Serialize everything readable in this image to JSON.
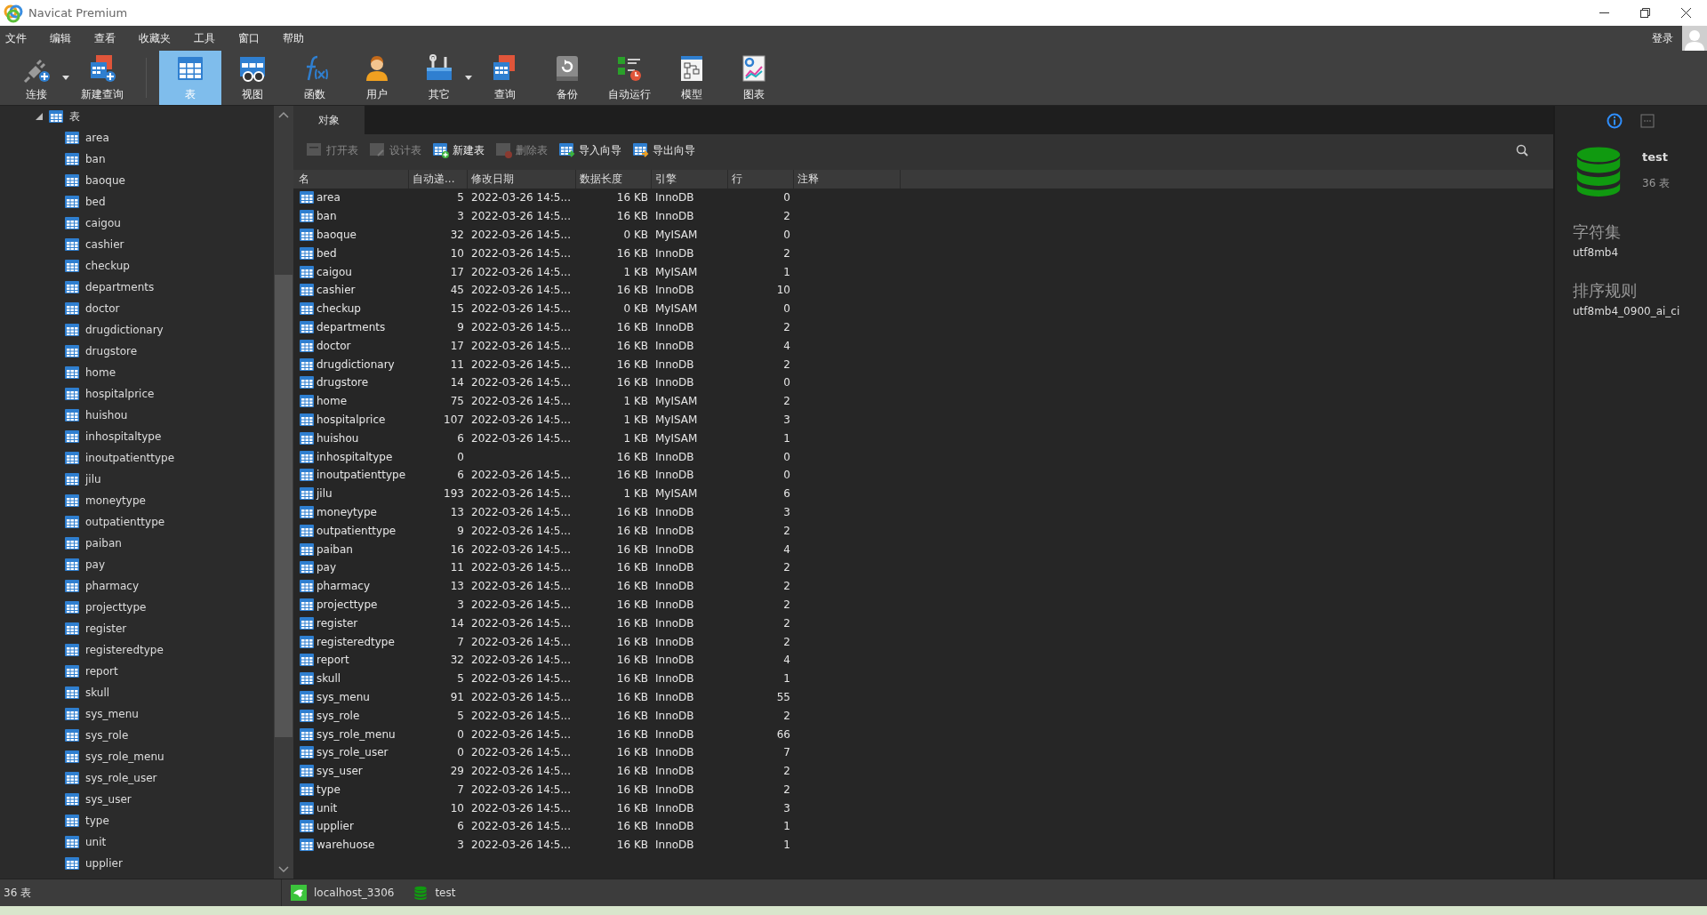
{
  "window": {
    "title": "Navicat Premium"
  },
  "menu": [
    "文件",
    "编辑",
    "查看",
    "收藏夹",
    "工具",
    "窗口",
    "帮助"
  ],
  "account": {
    "label": "登录"
  },
  "toolbar": [
    {
      "label": "连接",
      "selected": false,
      "dropdown": true
    },
    {
      "label": "新建查询",
      "selected": false,
      "dropdown": false
    },
    {
      "label": "表",
      "selected": true,
      "dropdown": false
    },
    {
      "label": "视图",
      "selected": false,
      "dropdown": false
    },
    {
      "label": "函数",
      "selected": false,
      "dropdown": false
    },
    {
      "label": "用户",
      "selected": false,
      "dropdown": false
    },
    {
      "label": "其它",
      "selected": false,
      "dropdown": true
    },
    {
      "label": "查询",
      "selected": false,
      "dropdown": false
    },
    {
      "label": "备份",
      "selected": false,
      "dropdown": false
    },
    {
      "label": "自动运行",
      "selected": false,
      "dropdown": false
    },
    {
      "label": "模型",
      "selected": false,
      "dropdown": false
    },
    {
      "label": "图表",
      "selected": false,
      "dropdown": false
    }
  ],
  "sidebar": {
    "items": [
      {
        "label": "表",
        "expanded": true,
        "children": [
          {
            "label": "area"
          },
          {
            "label": "ban"
          },
          {
            "label": "baoque"
          },
          {
            "label": "bed"
          },
          {
            "label": "caigou"
          },
          {
            "label": "cashier"
          },
          {
            "label": "checkup"
          },
          {
            "label": "departments"
          },
          {
            "label": "doctor"
          },
          {
            "label": "drugdictionary"
          },
          {
            "label": "drugstore"
          },
          {
            "label": "home"
          },
          {
            "label": "hospitalprice"
          },
          {
            "label": "huishou"
          },
          {
            "label": "inhospitaltype"
          },
          {
            "label": "inoutpatienttype"
          },
          {
            "label": "jilu"
          },
          {
            "label": "moneytype"
          },
          {
            "label": "outpatienttype"
          },
          {
            "label": "paiban"
          },
          {
            "label": "pay"
          },
          {
            "label": "pharmacy"
          },
          {
            "label": "projecttype"
          },
          {
            "label": "register"
          },
          {
            "label": "registeredtype"
          },
          {
            "label": "report"
          },
          {
            "label": "skull"
          },
          {
            "label": "sys_menu"
          },
          {
            "label": "sys_role"
          },
          {
            "label": "sys_role_menu"
          },
          {
            "label": "sys_role_user"
          },
          {
            "label": "sys_user"
          },
          {
            "label": "type"
          },
          {
            "label": "unit"
          },
          {
            "label": "upplier"
          }
        ]
      }
    ]
  },
  "tabs": [
    {
      "label": "对象",
      "selected": true
    }
  ],
  "actions": [
    {
      "label": "打开表",
      "disabled": true
    },
    {
      "label": "设计表",
      "disabled": true
    },
    {
      "label": "新建表",
      "disabled": false
    },
    {
      "label": "删除表",
      "disabled": true
    },
    {
      "label": "导入向导",
      "disabled": false
    },
    {
      "label": "导出向导",
      "disabled": false
    }
  ],
  "table": {
    "columns": [
      "名",
      "自动递...",
      "修改日期",
      "数据长度",
      "引擎",
      "行",
      "注释"
    ],
    "rows": [
      [
        "area",
        "5",
        "2022-03-26 14:5...",
        "16 KB",
        "InnoDB",
        "0"
      ],
      [
        "ban",
        "3",
        "2022-03-26 14:5...",
        "16 KB",
        "InnoDB",
        "2"
      ],
      [
        "baoque",
        "32",
        "2022-03-26 14:5...",
        "0 KB",
        "MyISAM",
        "0"
      ],
      [
        "bed",
        "10",
        "2022-03-26 14:5...",
        "16 KB",
        "InnoDB",
        "2"
      ],
      [
        "caigou",
        "17",
        "2022-03-26 14:5...",
        "1 KB",
        "MyISAM",
        "1"
      ],
      [
        "cashier",
        "45",
        "2022-03-26 14:5...",
        "16 KB",
        "InnoDB",
        "10"
      ],
      [
        "checkup",
        "15",
        "2022-03-26 14:5...",
        "0 KB",
        "MyISAM",
        "0"
      ],
      [
        "departments",
        "9",
        "2022-03-26 14:5...",
        "16 KB",
        "InnoDB",
        "2"
      ],
      [
        "doctor",
        "17",
        "2022-03-26 14:5...",
        "16 KB",
        "InnoDB",
        "4"
      ],
      [
        "drugdictionary",
        "11",
        "2022-03-26 14:5...",
        "16 KB",
        "InnoDB",
        "2"
      ],
      [
        "drugstore",
        "14",
        "2022-03-26 14:5...",
        "16 KB",
        "InnoDB",
        "0"
      ],
      [
        "home",
        "75",
        "2022-03-26 14:5...",
        "1 KB",
        "MyISAM",
        "2"
      ],
      [
        "hospitalprice",
        "107",
        "2022-03-26 14:5...",
        "1 KB",
        "MyISAM",
        "3"
      ],
      [
        "huishou",
        "6",
        "2022-03-26 14:5...",
        "1 KB",
        "MyISAM",
        "1"
      ],
      [
        "inhospitaltype",
        "0",
        "",
        "16 KB",
        "InnoDB",
        "0"
      ],
      [
        "inoutpatienttype",
        "6",
        "2022-03-26 14:5...",
        "16 KB",
        "InnoDB",
        "0"
      ],
      [
        "jilu",
        "193",
        "2022-03-26 14:5...",
        "1 KB",
        "MyISAM",
        "6"
      ],
      [
        "moneytype",
        "13",
        "2022-03-26 14:5...",
        "16 KB",
        "InnoDB",
        "3"
      ],
      [
        "outpatienttype",
        "9",
        "2022-03-26 14:5...",
        "16 KB",
        "InnoDB",
        "2"
      ],
      [
        "paiban",
        "16",
        "2022-03-26 14:5...",
        "16 KB",
        "InnoDB",
        "4"
      ],
      [
        "pay",
        "11",
        "2022-03-26 14:5...",
        "16 KB",
        "InnoDB",
        "2"
      ],
      [
        "pharmacy",
        "13",
        "2022-03-26 14:5...",
        "16 KB",
        "InnoDB",
        "2"
      ],
      [
        "projecttype",
        "3",
        "2022-03-26 14:5...",
        "16 KB",
        "InnoDB",
        "2"
      ],
      [
        "register",
        "14",
        "2022-03-26 14:5...",
        "16 KB",
        "InnoDB",
        "2"
      ],
      [
        "registeredtype",
        "7",
        "2022-03-26 14:5...",
        "16 KB",
        "InnoDB",
        "2"
      ],
      [
        "report",
        "32",
        "2022-03-26 14:5...",
        "16 KB",
        "InnoDB",
        "4"
      ],
      [
        "skull",
        "5",
        "2022-03-26 14:5...",
        "16 KB",
        "InnoDB",
        "1"
      ],
      [
        "sys_menu",
        "91",
        "2022-03-26 14:5...",
        "16 KB",
        "InnoDB",
        "55"
      ],
      [
        "sys_role",
        "5",
        "2022-03-26 14:5...",
        "16 KB",
        "InnoDB",
        "2"
      ],
      [
        "sys_role_menu",
        "0",
        "2022-03-26 14:5...",
        "16 KB",
        "InnoDB",
        "66"
      ],
      [
        "sys_role_user",
        "0",
        "2022-03-26 14:5...",
        "16 KB",
        "InnoDB",
        "7"
      ],
      [
        "sys_user",
        "29",
        "2022-03-26 14:5...",
        "16 KB",
        "InnoDB",
        "2"
      ],
      [
        "type",
        "7",
        "2022-03-26 14:5...",
        "16 KB",
        "InnoDB",
        "2"
      ],
      [
        "unit",
        "10",
        "2022-03-26 14:5...",
        "16 KB",
        "InnoDB",
        "3"
      ],
      [
        "upplier",
        "6",
        "2022-03-26 14:5...",
        "16 KB",
        "InnoDB",
        "1"
      ],
      [
        "warehuose",
        "3",
        "2022-03-26 14:5...",
        "16 KB",
        "InnoDB",
        "1"
      ]
    ]
  },
  "info_panel": {
    "name": "test",
    "count": "36 表",
    "charset_label": "字符集",
    "charset": "utf8mb4",
    "collation_label": "排序规则",
    "collation": "utf8mb4_0900_ai_ci"
  },
  "status_bar": {
    "count": "36 表",
    "connection": "localhost_3306",
    "database": "test"
  }
}
